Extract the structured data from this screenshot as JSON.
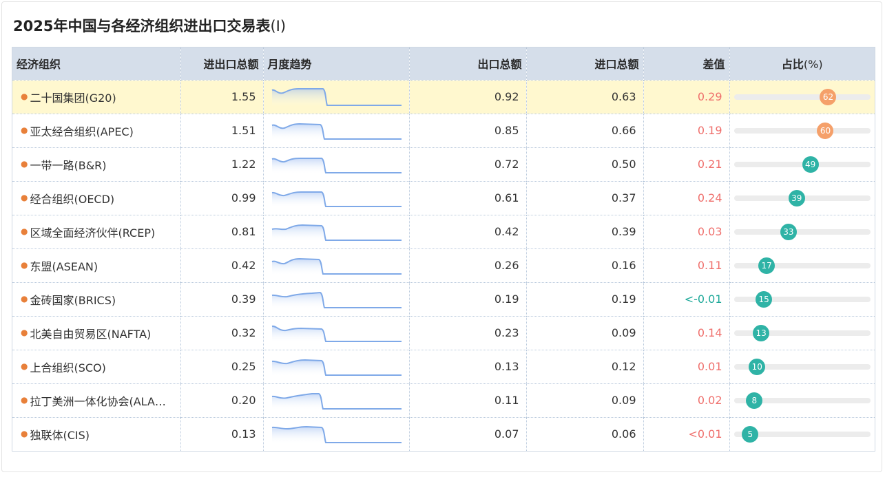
{
  "page": {
    "title": "2025年中国与各经济组织进出口交易表",
    "title_suffix": "(Ⅰ)"
  },
  "columns": {
    "org": "经济组织",
    "total": "进出口总额",
    "trend": "月度趋势",
    "export": "出口总额",
    "import": "进口总额",
    "diff": "差值",
    "share": "占比",
    "share_unit": "(%)"
  },
  "colors": {
    "header_bg": "#d5deea",
    "highlight_row": "#fff8cf",
    "positive_diff": "#ef6f6c",
    "negative_diff": "#1fa99a",
    "share_high": "#f5a06a",
    "share_normal": "#2fb3a6",
    "sparkline": "#7fa9e8",
    "bullet": "#e8803a"
  },
  "rows": [
    {
      "name": "二十国集团(G20)",
      "total": "1.55",
      "export": "0.92",
      "import": "0.63",
      "diff": "0.29",
      "share": 62,
      "highlight": true
    },
    {
      "name": "亚太经合组织(APEC)",
      "total": "1.51",
      "export": "0.85",
      "import": "0.66",
      "diff": "0.19",
      "share": 60
    },
    {
      "name": "一带一路(B&R)",
      "total": "1.22",
      "export": "0.72",
      "import": "0.50",
      "diff": "0.21",
      "share": 49
    },
    {
      "name": "经合组织(OECD)",
      "total": "0.99",
      "export": "0.61",
      "import": "0.37",
      "diff": "0.24",
      "share": 39
    },
    {
      "name": "区域全面经济伙伴(RCEP)",
      "total": "0.81",
      "export": "0.42",
      "import": "0.39",
      "diff": "0.03",
      "share": 33
    },
    {
      "name": "东盟(ASEAN)",
      "total": "0.42",
      "export": "0.26",
      "import": "0.16",
      "diff": "0.11",
      "share": 17
    },
    {
      "name": "金砖国家(BRICS)",
      "total": "0.39",
      "export": "0.19",
      "import": "0.19",
      "diff": "<-0.01",
      "share": 15,
      "negative": true
    },
    {
      "name": "北美自由贸易区(NAFTA)",
      "total": "0.32",
      "export": "0.23",
      "import": "0.09",
      "diff": "0.14",
      "share": 13
    },
    {
      "name": "上合组织(SCO)",
      "total": "0.25",
      "export": "0.13",
      "import": "0.12",
      "diff": "0.01",
      "share": 10
    },
    {
      "name": "拉丁美洲一体化协会(ALA…",
      "total": "0.20",
      "export": "0.11",
      "import": "0.09",
      "diff": "0.02",
      "share": 8
    },
    {
      "name": "独联体(CIS)",
      "total": "0.13",
      "export": "0.07",
      "import": "0.06",
      "diff": "<0.01",
      "share": 5
    }
  ]
}
